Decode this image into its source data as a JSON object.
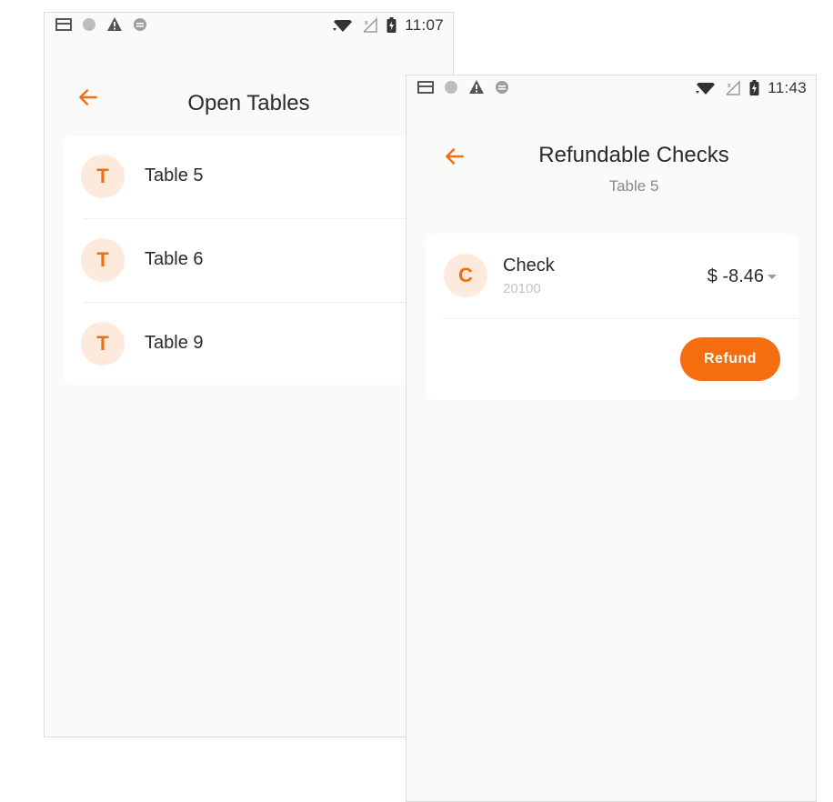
{
  "colors": {
    "accent": "#f56d0f",
    "avatar_bg": "#fdeadd",
    "screen_bg": "#fafaf9",
    "card_bg": "#ffffff"
  },
  "left_screen": {
    "status_bar": {
      "time": "11:07",
      "left_icons": [
        "sim-card-icon",
        "circle-icon",
        "alert-icon",
        "sync-icon"
      ],
      "right_icons": [
        "wifi-icon",
        "no-signal-icon",
        "battery-charging-icon"
      ]
    },
    "header": {
      "title": "Open Tables",
      "back_icon": "arrow-left-icon"
    },
    "tables": [
      {
        "avatar": "T",
        "label": "Table 5"
      },
      {
        "avatar": "T",
        "label": "Table 6"
      },
      {
        "avatar": "T",
        "label": "Table 9"
      }
    ]
  },
  "right_screen": {
    "status_bar": {
      "time": "11:43",
      "left_icons": [
        "sim-card-icon",
        "circle-icon",
        "alert-icon",
        "sync-icon"
      ],
      "right_icons": [
        "wifi-icon",
        "no-signal-icon",
        "battery-charging-icon"
      ]
    },
    "header": {
      "title": "Refundable Checks",
      "subtitle": "Table 5",
      "back_icon": "arrow-left-icon"
    },
    "check": {
      "avatar": "C",
      "title": "Check",
      "number": "20100",
      "amount": "$ -8.46",
      "refund_label": "Refund"
    }
  }
}
